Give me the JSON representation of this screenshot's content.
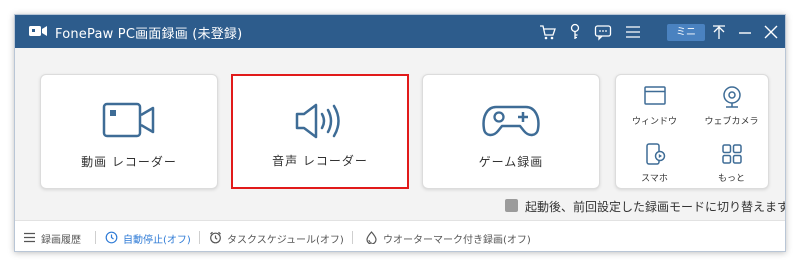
{
  "app": {
    "title": "FonePaw PC画面録画 (未登録)",
    "logo_icon": "camera-logo-icon"
  },
  "titlebar": {
    "icons": [
      "cart-icon",
      "key-icon",
      "chat-icon",
      "menu-icon",
      "pin-icon",
      "minimize-icon",
      "close-icon"
    ],
    "mini_label": "ミニ"
  },
  "cards": [
    {
      "label": "動画 レコーダー",
      "icon": "video-camera-icon"
    },
    {
      "label": "音声 レコーダー",
      "icon": "speaker-icon",
      "selected": true
    },
    {
      "label": "ゲーム録画",
      "icon": "gamepad-icon"
    }
  ],
  "mini_items": [
    {
      "label": "ウィンドウ",
      "icon": "window-icon"
    },
    {
      "label": "ウェブカメラ",
      "icon": "webcam-icon"
    },
    {
      "label": "スマホ",
      "icon": "phone-icon"
    },
    {
      "label": "もっと",
      "icon": "more-grid-icon"
    }
  ],
  "remember": {
    "label": "起動後、前回設定した録画モードに切り替えます",
    "checked": false
  },
  "bottombar": {
    "items": [
      {
        "label": "録画履歴",
        "icon": "list-icon",
        "active": false
      },
      {
        "label": "自動停止(オフ)",
        "icon": "clock-icon",
        "active": true
      },
      {
        "label": "タスクスケジュール(オフ)",
        "icon": "alarm-icon",
        "active": false
      },
      {
        "label": "ウオーターマーク付き録画(オフ)",
        "icon": "watermark-icon",
        "active": false
      }
    ]
  },
  "colors": {
    "titlebar": "#2d5c8c",
    "accent_blue": "#2f7bd6",
    "selection_red": "#e11a1a",
    "icon_blue": "#3e6c96"
  }
}
